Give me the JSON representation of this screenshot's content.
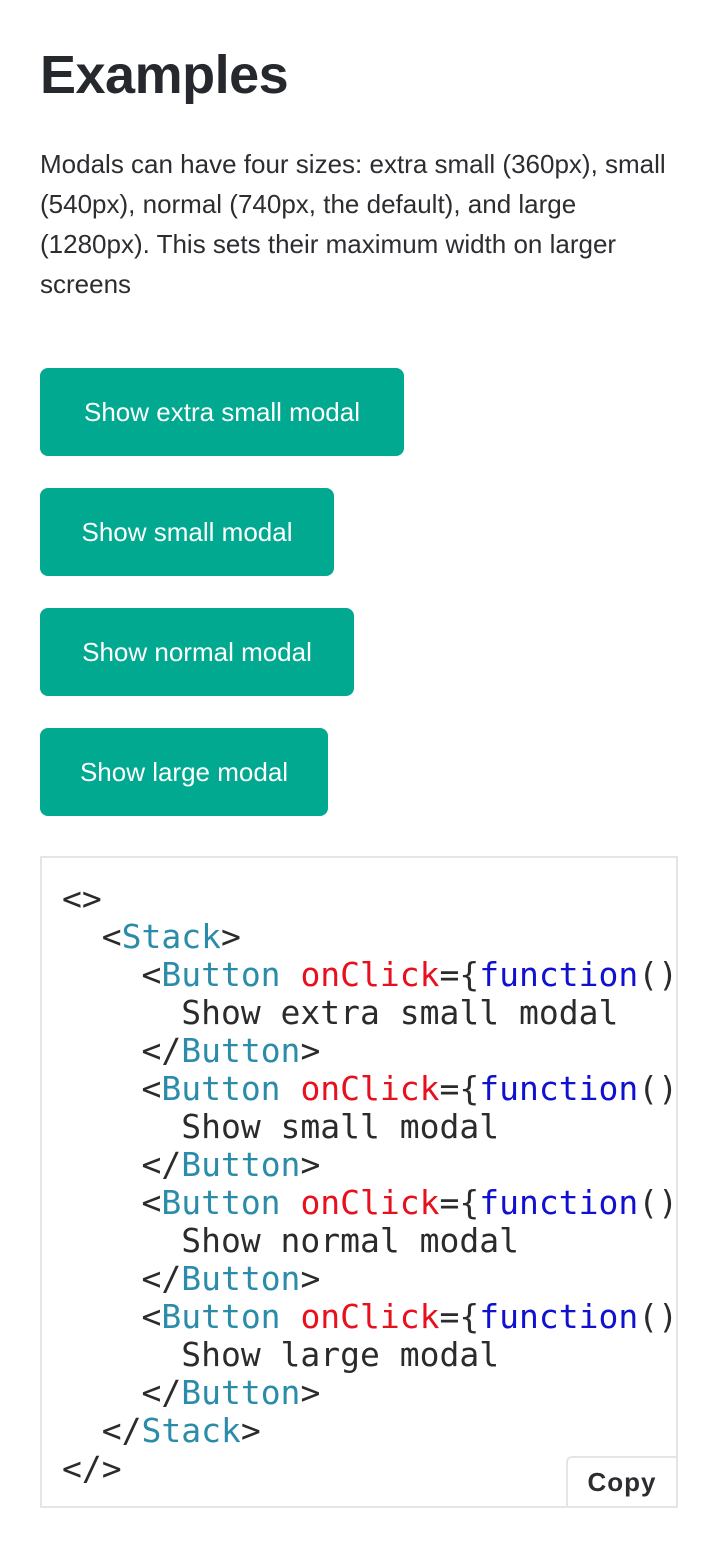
{
  "heading": "Examples",
  "description": "Modals can have four sizes: extra small (360px), small (540px), normal (740px, the default), and large (1280px). This sets their maximum width on larger screens",
  "buttons": [
    {
      "label": "Show extra small modal"
    },
    {
      "label": "Show small modal"
    },
    {
      "label": "Show normal modal"
    },
    {
      "label": "Show large modal"
    }
  ],
  "code": {
    "fragment_open": "<>",
    "fragment_close": "</>",
    "stack_tag": "Stack",
    "button_tag": "Button",
    "attr_name": "onClick",
    "keyword": "function",
    "lines_text": [
      "Show extra small modal",
      "Show small modal",
      "Show normal modal",
      "Show large modal"
    ],
    "copy_label": "Copy"
  },
  "colors": {
    "button_bg": "#00a98f",
    "tag": "#2a8ca9",
    "attr": "#e8101c",
    "keyword": "#1010d0"
  }
}
